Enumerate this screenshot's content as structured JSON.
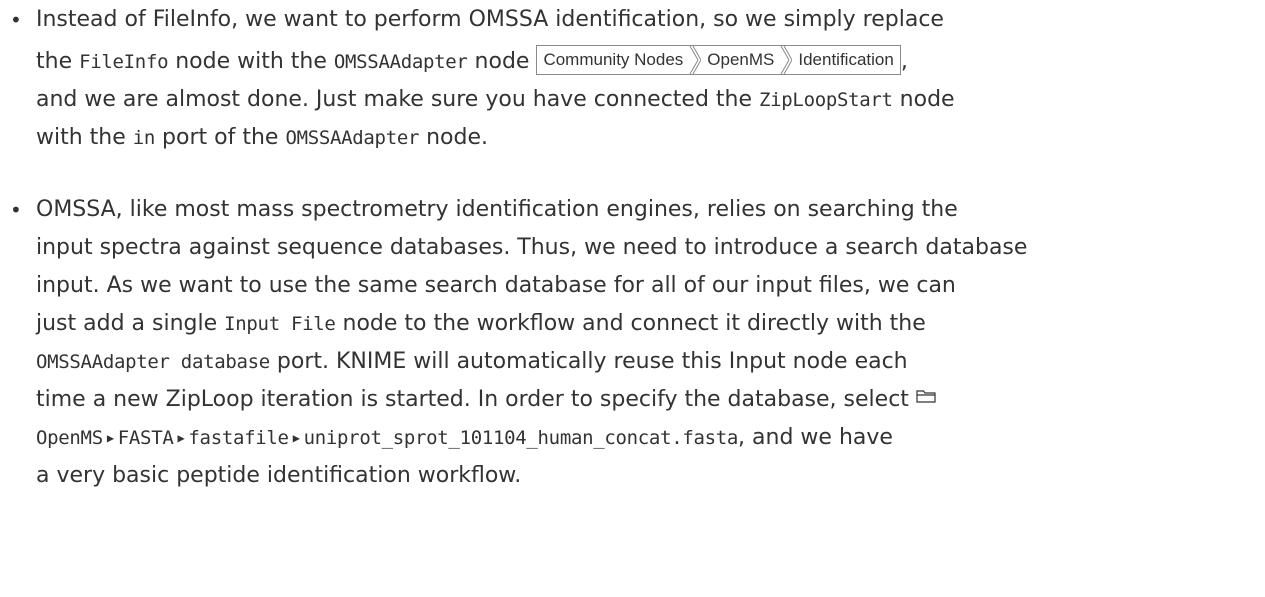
{
  "bullets": [
    {
      "lines": [
        {
          "t1": "Instead of FileInfo, we want to perform OMSSA identification, so we simply replace"
        },
        {
          "t1": "the ",
          "c1": "FileInfo",
          "t2": " node with the ",
          "c2": "OMSSAAdapter",
          "t3": " node ",
          "t4": ","
        },
        {
          "t1": "and we are almost done. Just make sure you have connected the ",
          "c1": "ZipLoopStart",
          "t2": " node"
        },
        {
          "t1": "with the ",
          "c1": "in",
          "t2": " port of the ",
          "c2": "OMSSAAdapter",
          "t3": " node."
        }
      ],
      "menu_path": [
        "Community Nodes",
        "OpenMS",
        "Identification"
      ]
    },
    {
      "lines": [
        {
          "t1": "OMSSA, like most mass spectrometry identification engines, relies on searching the"
        },
        {
          "t1": "input spectra against sequence databases. Thus, we need to introduce a search database"
        },
        {
          "t1": "input.  As we want to use the same search database for all of our input files, we can"
        },
        {
          "t1": "just add a single ",
          "c1": "Input File",
          "t2": " node to the workflow and connect it directly with the"
        },
        {
          "c1": "OMSSAAdapter database",
          "t1": " port.  KNIME will automatically reuse this Input node each"
        },
        {
          "t1": "time a new ZipLoop iteration is started.  In order to specify the database, select "
        },
        {
          "t1": ", and we have"
        },
        {
          "t1": "a very basic peptide identification workflow."
        }
      ],
      "file_path": [
        "OpenMS",
        "FASTA",
        "fastafile",
        "uniprot_sprot_101104_human_concat.fasta"
      ]
    }
  ]
}
